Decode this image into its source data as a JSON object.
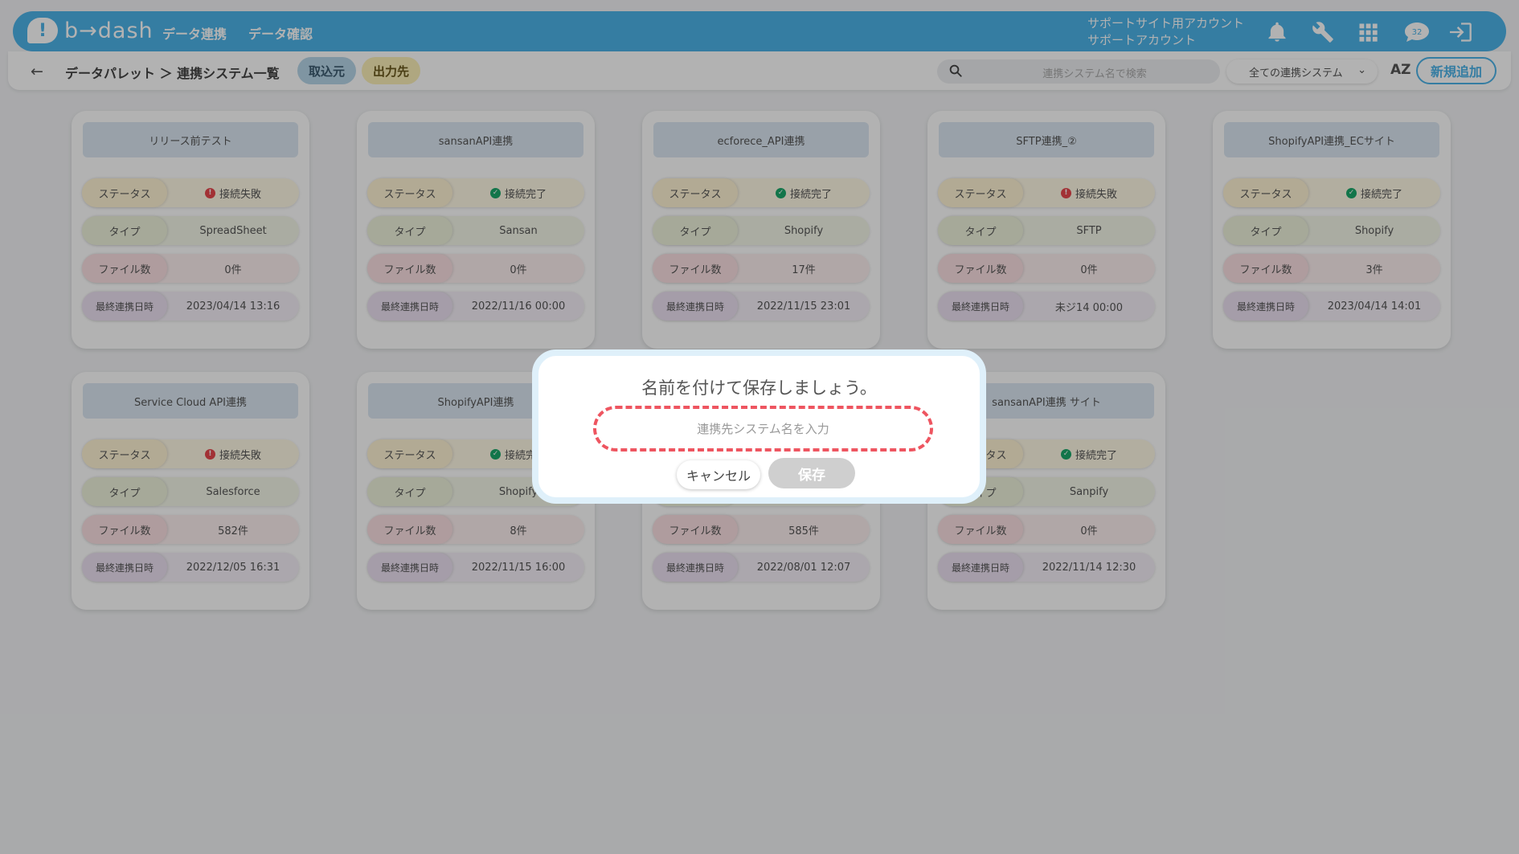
{
  "header": {
    "logo_text": "b→dash",
    "nav": [
      "データ連携",
      "データ確認"
    ],
    "account_line1": "サポートサイト用アカウント",
    "account_line2": "サポートアカウント",
    "chat_badge": "32",
    "brand_color": "#4db3e8"
  },
  "toolbar": {
    "back": "←",
    "breadcrumb": "データパレット ＞ 連携システム一覧",
    "tab_import": "取込元",
    "tab_export": "出力先",
    "search_placeholder": "連携システム名で検索",
    "filter_value": "全ての連携システム",
    "sort_label": "AZ",
    "add_button": "新規追加"
  },
  "labels": {
    "status": "ステータス",
    "type": "タイプ",
    "files": "ファイル数",
    "last_sync": "最終連携日時"
  },
  "cards": [
    {
      "title": "リリース前テスト",
      "status": "接続失敗",
      "status_ok": false,
      "type": "SpreadSheet",
      "files": "0件",
      "date": "2023/04/14 13:16"
    },
    {
      "title": "sansanAPI連携",
      "status": "接続完了",
      "status_ok": true,
      "type": "Sansan",
      "files": "0件",
      "date": "2022/11/16 00:00"
    },
    {
      "title": "ecforece_API連携",
      "status": "接続完了",
      "status_ok": true,
      "type": "Shopify",
      "files": "17件",
      "date": "2022/11/15 23:01"
    },
    {
      "title": "SFTP連携_②",
      "status": "接続失敗",
      "status_ok": false,
      "type": "SFTP",
      "files": "0件",
      "date": "未ジ14 00:00"
    },
    {
      "title": "ShopifyAPI連携_ECサイト",
      "status": "接続完了",
      "status_ok": true,
      "type": "Shopify",
      "files": "3件",
      "date": "2023/04/14 14:01"
    },
    {
      "title": "Service Cloud API連携",
      "status": "接続失敗",
      "status_ok": false,
      "type": "Salesforce",
      "files": "582件",
      "date": "2022/12/05 16:31"
    },
    {
      "title": "ShopifyAPI連携",
      "status": "接続完了",
      "status_ok": true,
      "type": "Shopify",
      "files": "8件",
      "date": "2022/11/15 16:00"
    },
    {
      "title": "",
      "status": "",
      "status_ok": true,
      "type": "",
      "files": "585件",
      "date": "2022/08/01 12:07"
    },
    {
      "title": "sansanAPI連携 サイト",
      "status": "接続完了",
      "status_ok": true,
      "type": "Sanpify",
      "files": "0件",
      "date": "2022/11/14 12:30"
    }
  ],
  "modal": {
    "title": "名前を付けて保存しましょう。",
    "input_placeholder": "連携先システム名を入力",
    "input_value": "",
    "cancel": "キャンセル",
    "save": "保存"
  }
}
